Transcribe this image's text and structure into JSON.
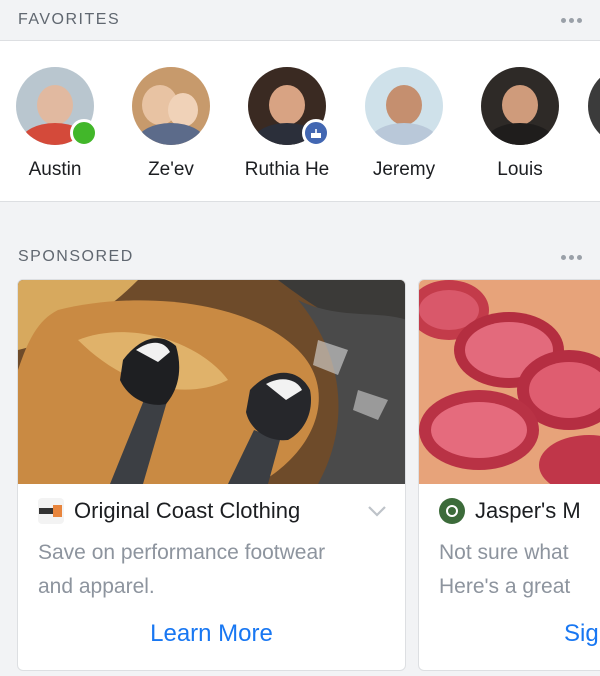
{
  "favorites": {
    "title": "FAVORITES",
    "people": [
      {
        "name": "Austin",
        "status": "online"
      },
      {
        "name": "Ze'ev",
        "status": ""
      },
      {
        "name": "Ruthia He",
        "status": "birthday"
      },
      {
        "name": "Jeremy",
        "status": ""
      },
      {
        "name": "Louis",
        "status": ""
      }
    ]
  },
  "sponsored": {
    "title": "SPONSORED",
    "ads": [
      {
        "brand": "Original Coast Clothing",
        "description_line1": "Save on performance footwear",
        "description_line2": "and apparel.",
        "cta": "Learn More"
      },
      {
        "brand": "Jasper's M",
        "description_line1": "Not sure what",
        "description_line2": "Here's a great",
        "cta": "Sig"
      }
    ]
  },
  "colors": {
    "accent": "#1877f2",
    "online": "#42b72a",
    "badge": "#4267b2",
    "muted_text": "#8d949e"
  }
}
